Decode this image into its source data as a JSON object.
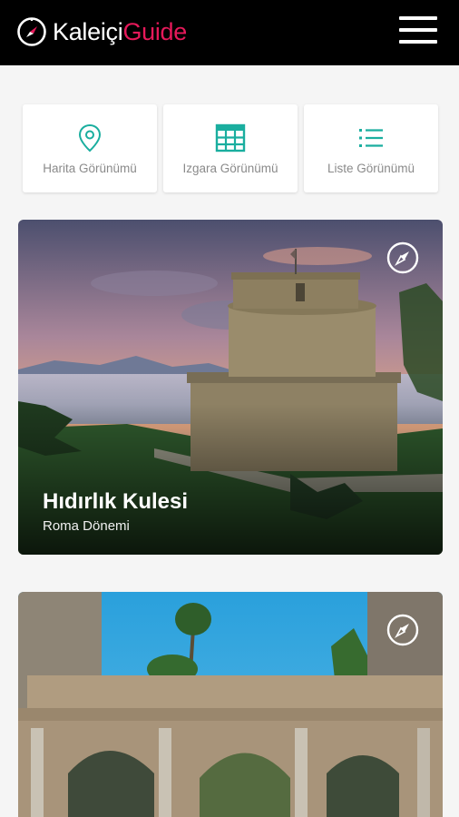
{
  "header": {
    "logo_text_white": "Kaleiçi",
    "logo_text_pink": "Guide",
    "brand_color": "#e6195a",
    "menu_icon": "hamburger-menu-icon"
  },
  "view_options": [
    {
      "label": "Harita Görünümü",
      "icon": "map-pin-icon"
    },
    {
      "label": "Izgara Görünümü",
      "icon": "grid-icon"
    },
    {
      "label": "Liste Görünümü",
      "icon": "list-icon"
    }
  ],
  "accent_color": "#1aae9f",
  "places": [
    {
      "title": "Hıdırlık Kulesi",
      "subtitle": "Roma Dönemi",
      "icon": "compass-icon"
    },
    {
      "title": "",
      "subtitle": "",
      "icon": "compass-icon"
    }
  ]
}
